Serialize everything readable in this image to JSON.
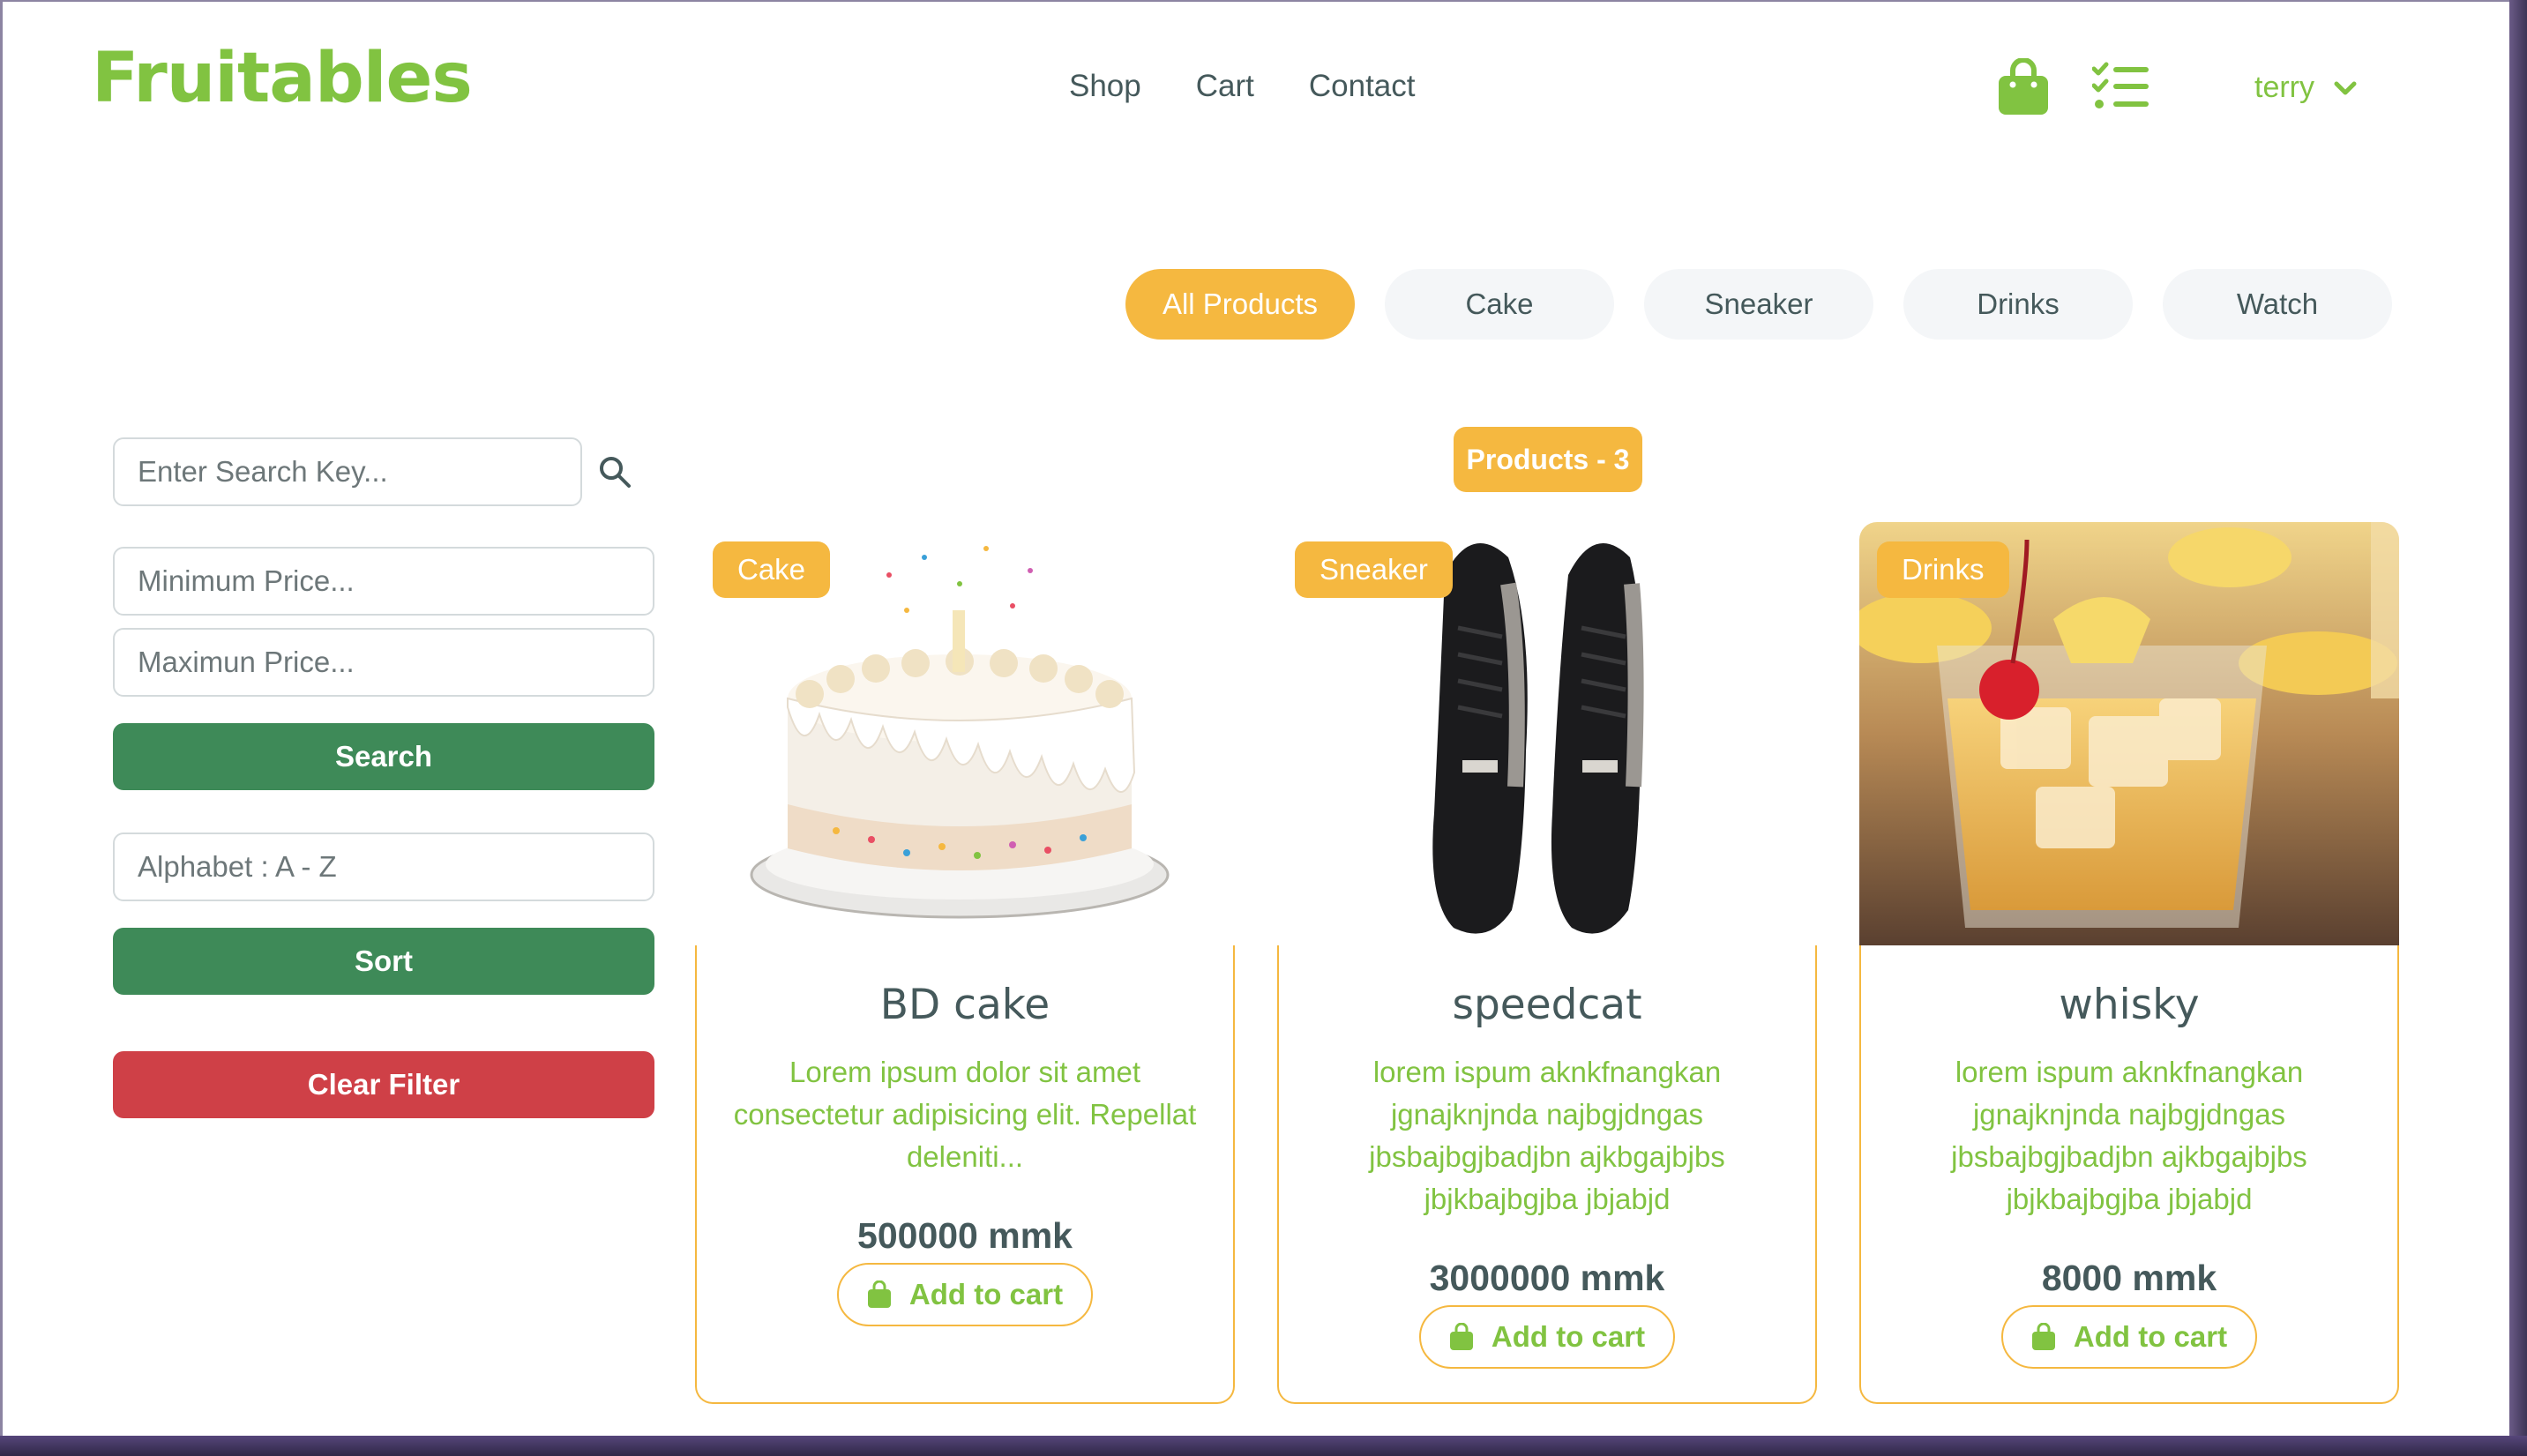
{
  "brand": {
    "name": "Fruitables",
    "color": "#81c341"
  },
  "nav": {
    "items": [
      "Shop",
      "Cart",
      "Contact"
    ]
  },
  "header_icons": [
    "shopping-bag-icon",
    "checklist-icon"
  ],
  "user": {
    "name": "terry"
  },
  "categories": {
    "items": [
      "All Products",
      "Cake",
      "Sneaker",
      "Drinks",
      "Watch"
    ],
    "active": "All Products"
  },
  "sidebar": {
    "search_placeholder": "Enter Search Key...",
    "min_price_placeholder": "Minimum Price...",
    "max_price_placeholder": "Maximun Price...",
    "search_label": "Search",
    "sort_value": "Alphabet : A - Z",
    "sort_label": "Sort",
    "clear_label": "Clear Filter"
  },
  "products_count_label": "Products - 3",
  "products": [
    {
      "category": "Cake",
      "name": "BD cake",
      "description": "Lorem ipsum dolor sit amet consectetur adipisicing elit. Repellat deleniti...",
      "price": "500000 mmk",
      "button": "Add to cart"
    },
    {
      "category": "Sneaker",
      "name": "speedcat",
      "description": "lorem ispum aknkfnangkan jgnajknjnda najbgjdngas jbsbajbgjbadjbn ajkbgajbjbs jbjkbajbgjba jbjabjd",
      "price": "3000000 mmk",
      "button": "Add to cart"
    },
    {
      "category": "Drinks",
      "name": "whisky",
      "description": "lorem ispum aknkfnangkan jgnajknjnda najbgjdngas jbsbajbgjbadjbn ajkbgajbjbs jbjkbajbgjba jbjabjd",
      "price": "8000 mmk",
      "button": "Add to cart"
    }
  ],
  "colors": {
    "accent": "#f5b840",
    "green_button": "#3e8a58",
    "red_button": "#cf4047",
    "text_dark": "#45595b"
  }
}
